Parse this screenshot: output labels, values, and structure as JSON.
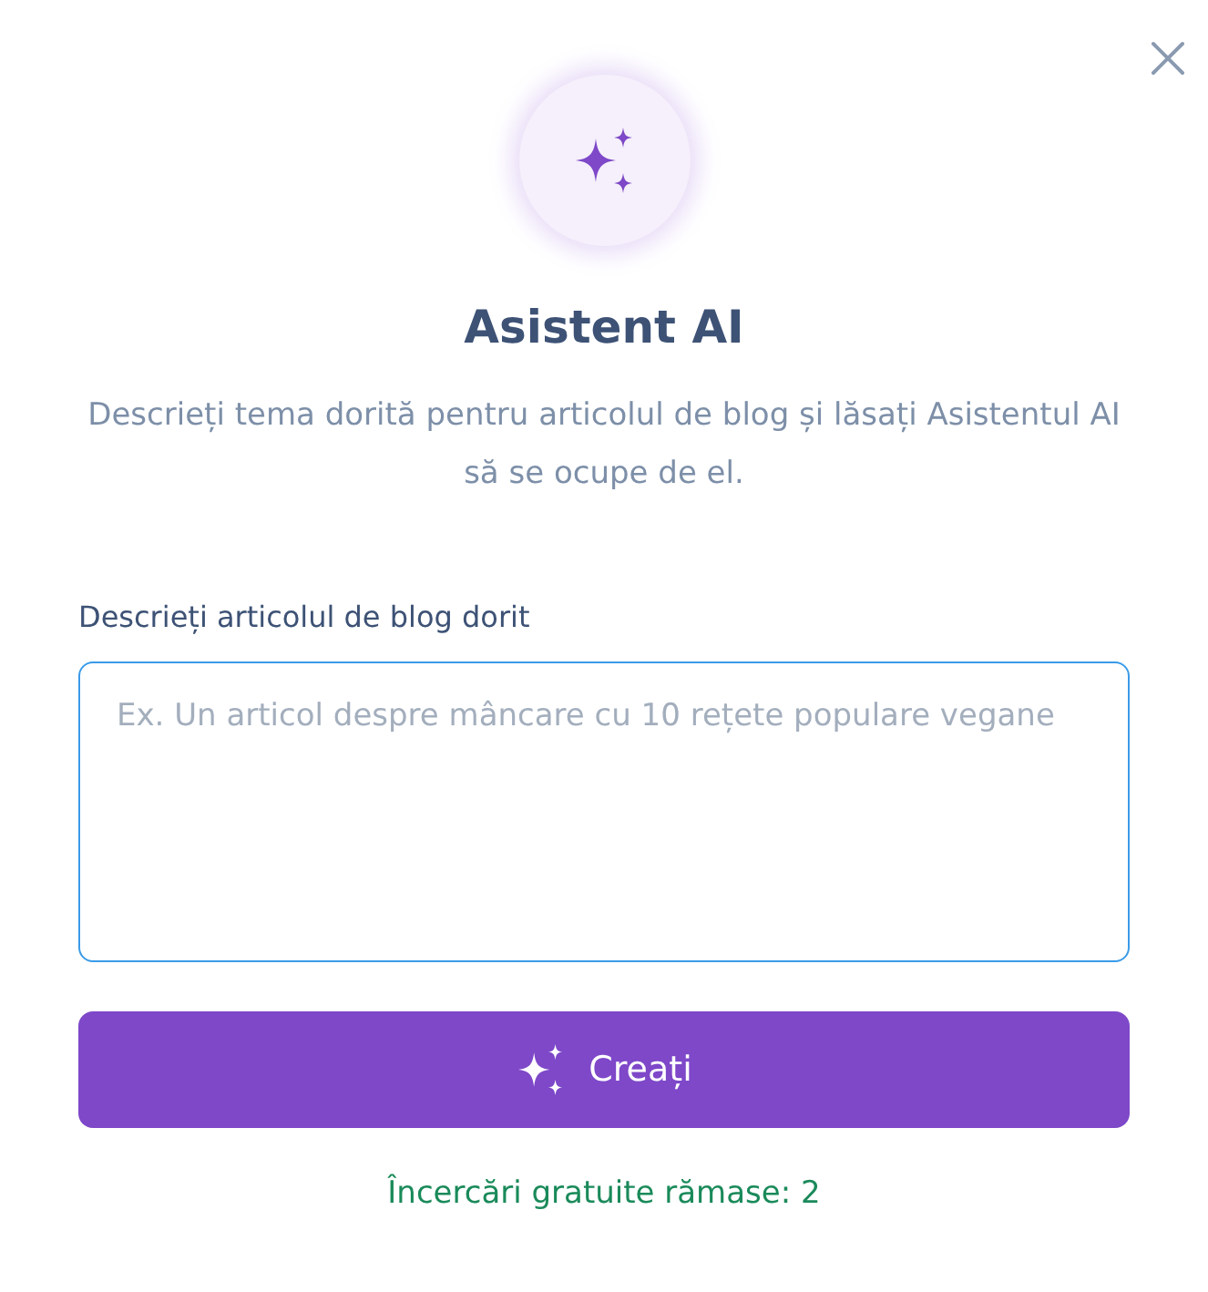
{
  "title": "Asistent AI",
  "description": "Descrieți tema dorită pentru articolul de blog și lăsați Asistentul AI să se ocupe de el.",
  "field": {
    "label": "Descrieți articolul de blog dorit",
    "placeholder": "Ex. Un articol despre mâncare cu 10 rețete populare vegane"
  },
  "button": {
    "label": "Creați"
  },
  "footer": "Încercări gratuite rămase: 2"
}
